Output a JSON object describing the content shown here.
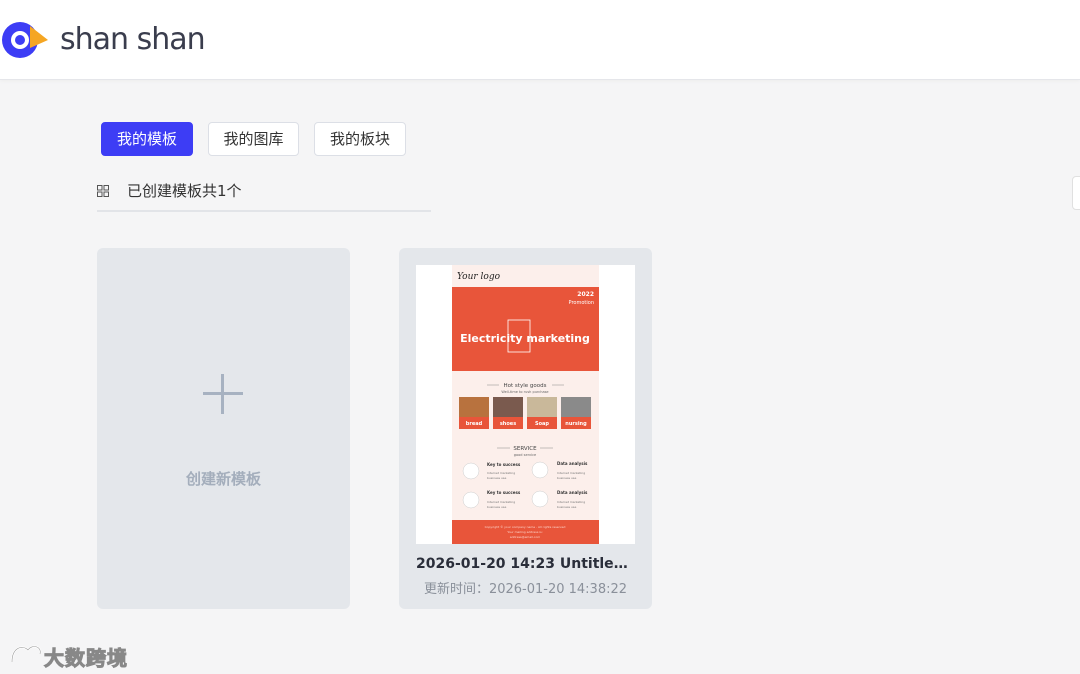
{
  "header": {
    "brand": "shan shan",
    "colors": {
      "brand_blue": "#3d3df5",
      "brand_orange": "#f5a623"
    }
  },
  "tabs": [
    {
      "label": "我的模板",
      "active": true
    },
    {
      "label": "我的图库",
      "active": false
    },
    {
      "label": "我的板块",
      "active": false
    }
  ],
  "summary": {
    "text": "已创建模板共1个",
    "icon": "grid-icon"
  },
  "new_card": {
    "label": "创建新模板",
    "icon": "plus-icon"
  },
  "templates": [
    {
      "title": "2026-01-20 14:23 Untitled tem...",
      "updated": "更新时间：2026-01-20 14:38:22",
      "thumbnail": {
        "logo": "Your logo",
        "year": "2022",
        "promo": "Promotion",
        "headline": "Electricity marketing",
        "section1": "Hot style goods",
        "section1_sub": "Well-time to rush purchase",
        "products": [
          "bread",
          "shoes",
          "Soap",
          "nursing"
        ],
        "section2": "SERVICE",
        "section2_sub": "good service",
        "services": [
          {
            "title": "Key to success",
            "line1": "Internet marketing",
            "line2": "business use"
          },
          {
            "title": "Data analysis",
            "line1": "Internet marketing",
            "line2": "business use"
          },
          {
            "title": "Key to success",
            "line1": "Internet marketing",
            "line2": "business use"
          },
          {
            "title": "Data analysis",
            "line1": "Internet marketing",
            "line2": "business use"
          }
        ],
        "footer_lines": [
          "Copyright © your company name . All rights reserved",
          "Your mailing address is:",
          "address@email.com"
        ],
        "colors": {
          "accent": "#e8553a",
          "panel": "#fcefeb"
        }
      }
    }
  ],
  "watermark": {
    "text": "大数跨境"
  }
}
